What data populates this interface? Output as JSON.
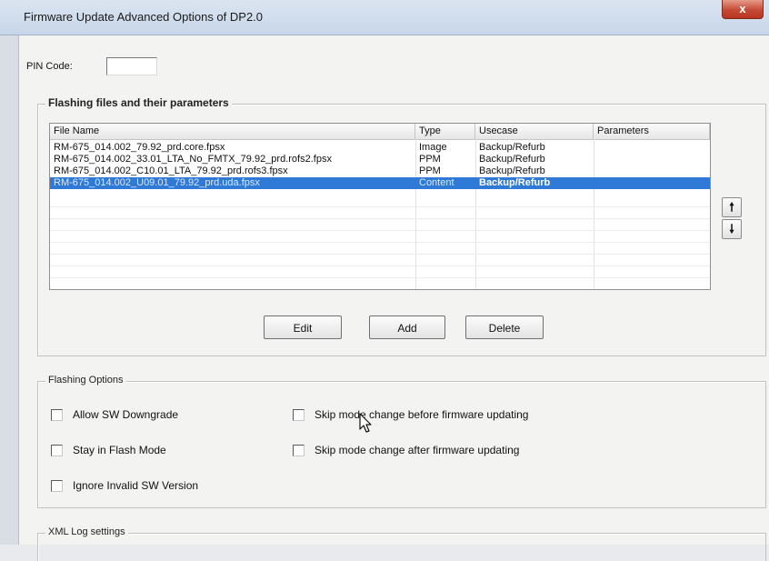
{
  "window": {
    "title": "Firmware Update Advanced Options of DP2.0",
    "close_glyph": "x"
  },
  "pin": {
    "label": "PIN Code:",
    "value": ""
  },
  "flashing_files": {
    "group_title": "Flashing files and their parameters",
    "columns": [
      "File Name",
      "Type",
      "Usecase",
      "Parameters"
    ],
    "rows": [
      {
        "file": "RM-675_014.002_79.92_prd.core.fpsx",
        "type": "Image",
        "usecase": "Backup/Refurb",
        "params": "",
        "selected": false
      },
      {
        "file": "RM-675_014.002_33.01_LTA_No_FMTX_79.92_prd.rofs2.fpsx",
        "type": "PPM",
        "usecase": "Backup/Refurb",
        "params": "",
        "selected": false
      },
      {
        "file": "RM-675_014.002_C10.01_LTA_79.92_prd.rofs3.fpsx",
        "type": "PPM",
        "usecase": "Backup/Refurb",
        "params": "",
        "selected": false
      },
      {
        "file": "RM-675_014.002_U09.01_79.92_prd.uda.fpsx",
        "type": "Content",
        "usecase": "Backup/Refurb",
        "params": "",
        "selected": true
      }
    ],
    "move_up_glyph": "🠕",
    "move_down_glyph": "🠗",
    "buttons": {
      "edit": "Edit",
      "add": "Add",
      "delete": "Delete"
    }
  },
  "flashing_options": {
    "group_title": "Flashing Options",
    "checkboxes": {
      "allow_sw_downgrade": {
        "label": "Allow SW Downgrade",
        "checked": false
      },
      "stay_in_flash_mode": {
        "label": "Stay in Flash Mode",
        "checked": false
      },
      "ignore_invalid_sw_version": {
        "label": "Ignore Invalid SW Version",
        "checked": false
      },
      "skip_mode_change_before": {
        "label": "Skip mode change before firmware updating",
        "checked": false
      },
      "skip_mode_change_after": {
        "label": "Skip mode change after firmware updating",
        "checked": false
      }
    }
  },
  "xml_log": {
    "group_title": "XML Log settings"
  },
  "icons": {
    "close": "close-icon",
    "move_up": "arrow-up-icon",
    "move_down": "arrow-down-icon",
    "cursor": "mouse-pointer-icon"
  },
  "colors": {
    "selection": "#2f7ad6",
    "close_button": "#c44a36",
    "titlebar": "#c7d6e9"
  }
}
